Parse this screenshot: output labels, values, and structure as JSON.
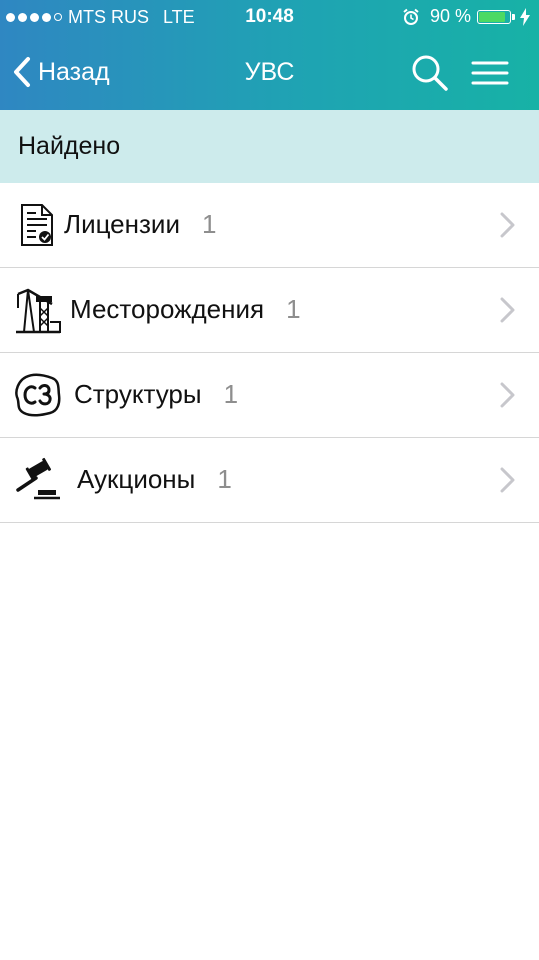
{
  "status_bar": {
    "carrier": "MTS RUS",
    "network": "LTE",
    "time": "10:48",
    "battery_percent": "90 %",
    "battery_level": 0.9,
    "signal_bars_filled": 4,
    "signal_bars_total": 5
  },
  "nav": {
    "back_label": "Назад",
    "title": "УВС"
  },
  "section": {
    "header": "Найдено"
  },
  "results": [
    {
      "label": "Лицензии",
      "count": "1",
      "icon": "license-document-icon"
    },
    {
      "label": "Месторождения",
      "count": "1",
      "icon": "oil-pump-icon"
    },
    {
      "label": "Структуры",
      "count": "1",
      "icon": "structure-c3-icon"
    },
    {
      "label": "Аукционы",
      "count": "1",
      "icon": "auction-gavel-icon"
    }
  ],
  "colors": {
    "header_gradient_start": "#2f87c2",
    "header_gradient_end": "#17b2a6",
    "section_bg": "#cdebec",
    "count_text": "#8e8e8e",
    "battery_fill": "#4cd964"
  }
}
